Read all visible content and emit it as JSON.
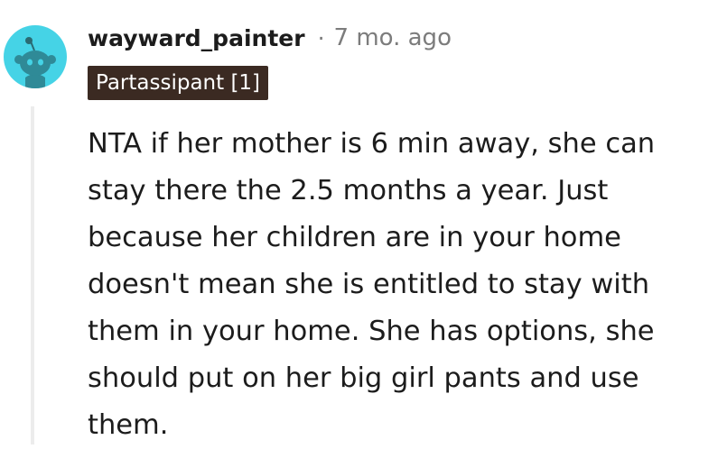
{
  "comment": {
    "author": "wayward_painter",
    "separator": "·",
    "timestamp": "7 mo. ago",
    "flair": "Partassipant [1]",
    "avatar_icon": "snoo-avatar-icon",
    "colors": {
      "avatar_bg": "#45d3e6",
      "flair_bg": "#3b2a22",
      "text": "#1c1c1c",
      "meta": "#7c7c7c"
    },
    "body_lines": [
      "NTA if her mother is 6 min away, she can",
      "stay there the 2.5 months a year. Just",
      "because her children are in your home",
      "doesn't mean she is entitled to stay with",
      "them in your home. She has options, she",
      "should put on her big girl pants and use",
      "them."
    ]
  }
}
